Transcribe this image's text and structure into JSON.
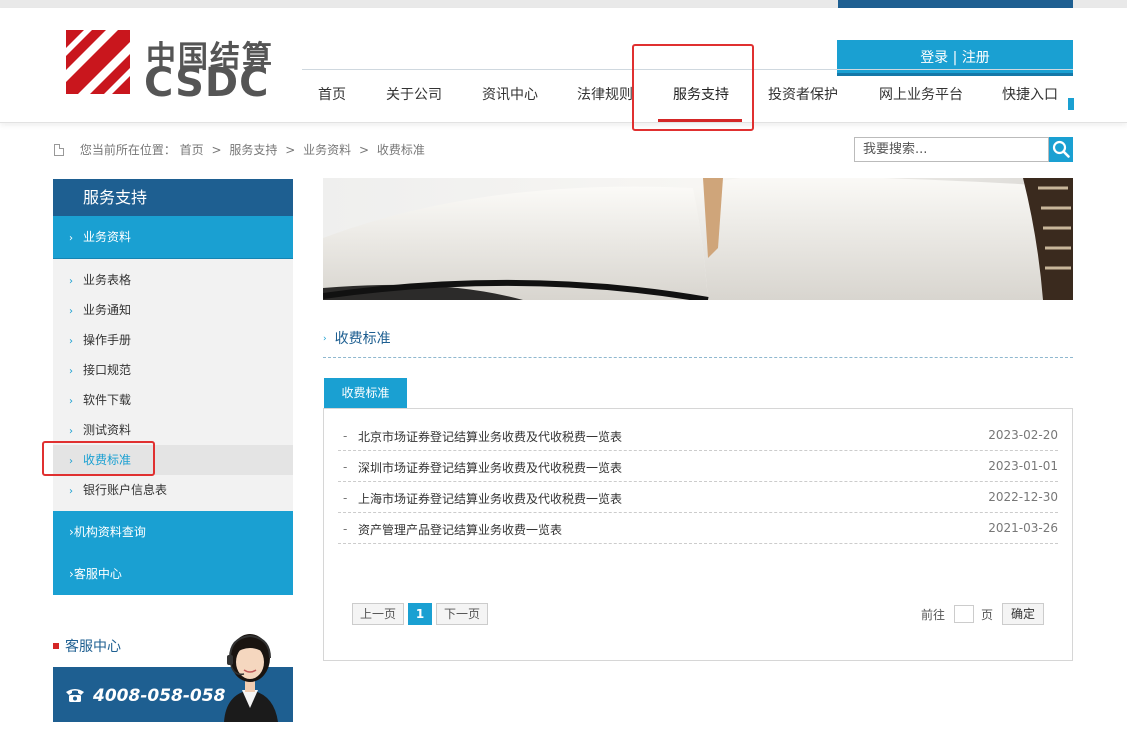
{
  "header": {
    "logo_cn": "中国结算",
    "logo_en": "CSDC",
    "login_label": "登录",
    "login_sep": "|",
    "register_label": "注册"
  },
  "nav": {
    "items": [
      "首页",
      "关于公司",
      "资讯中心",
      "法律规则",
      "服务支持",
      "投资者保护",
      "网上业务平台",
      "快捷入口"
    ],
    "active": "服务支持"
  },
  "breadcrumb": {
    "prefix": "您当前所在位置：",
    "items": [
      "首页",
      "服务支持",
      "业务资料",
      "收费标准"
    ],
    "separator": ">"
  },
  "search": {
    "placeholder": "我要搜索..."
  },
  "sidebar": {
    "title": "服务支持",
    "section1": "业务资料",
    "sub_items": [
      "业务表格",
      "业务通知",
      "操作手册",
      "接口规范",
      "软件下载",
      "测试资料",
      "收费标准",
      "银行账户信息表"
    ],
    "active_sub": "收费标准",
    "section2": "机构资料查询",
    "section3": "客服中心"
  },
  "customer_service": {
    "title": "客服中心",
    "hotline": "4008-058-058"
  },
  "content": {
    "section_title": "收费标准",
    "tab_label": "收费标准",
    "rows": [
      {
        "title": "北京市场证券登记结算业务收费及代收税费一览表",
        "date": "2023-02-20"
      },
      {
        "title": "深圳市场证券登记结算业务收费及代收税费一览表",
        "date": "2023-01-01"
      },
      {
        "title": "上海市场证券登记结算业务收费及代收税费一览表",
        "date": "2022-12-30"
      },
      {
        "title": "资产管理产品登记结算业务收费一览表",
        "date": "2021-03-26"
      }
    ]
  },
  "pagination": {
    "prev": "上一页",
    "current": "1",
    "next": "下一页",
    "goto_label": "前往",
    "page_label": "页",
    "confirm": "确定"
  },
  "colors": {
    "brand_dark": "#1e5f91",
    "brand_light": "#1aa0d2",
    "accent_red": "#d42626"
  }
}
